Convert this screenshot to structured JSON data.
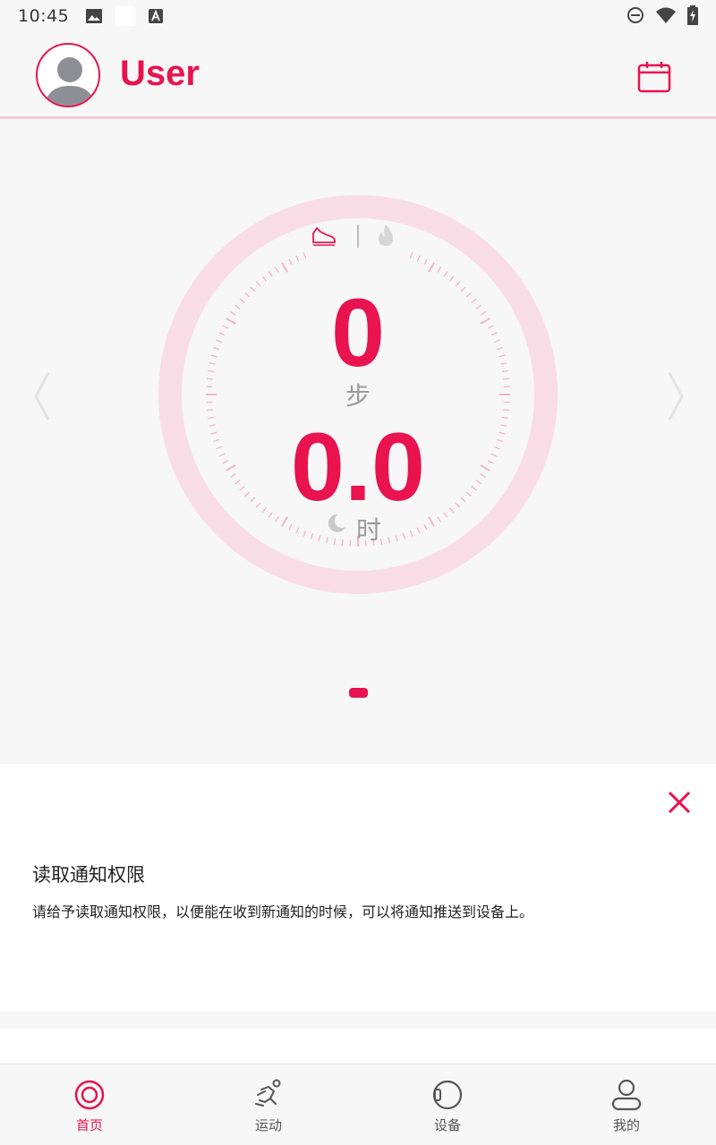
{
  "status_bar": {
    "time": "10:45"
  },
  "header": {
    "username": "User"
  },
  "dial": {
    "steps_value": "0",
    "steps_unit": "步",
    "sleep_value": "0.0",
    "sleep_unit": "时"
  },
  "notice": {
    "title": "读取通知权限",
    "body": "请给予读取通知权限，以便能在收到新通知的时候，可以将通知推送到设备上。"
  },
  "bottom_nav": {
    "items": [
      {
        "label": "首页",
        "icon": "home-target-icon",
        "active": true
      },
      {
        "label": "运动",
        "icon": "running-icon",
        "active": false
      },
      {
        "label": "设备",
        "icon": "watch-icon",
        "active": false
      },
      {
        "label": "我的",
        "icon": "person-icon",
        "active": false
      }
    ]
  },
  "colors": {
    "accent": "#e8134f",
    "ring": "#f8dde6",
    "tick": "#f3b4c8"
  }
}
